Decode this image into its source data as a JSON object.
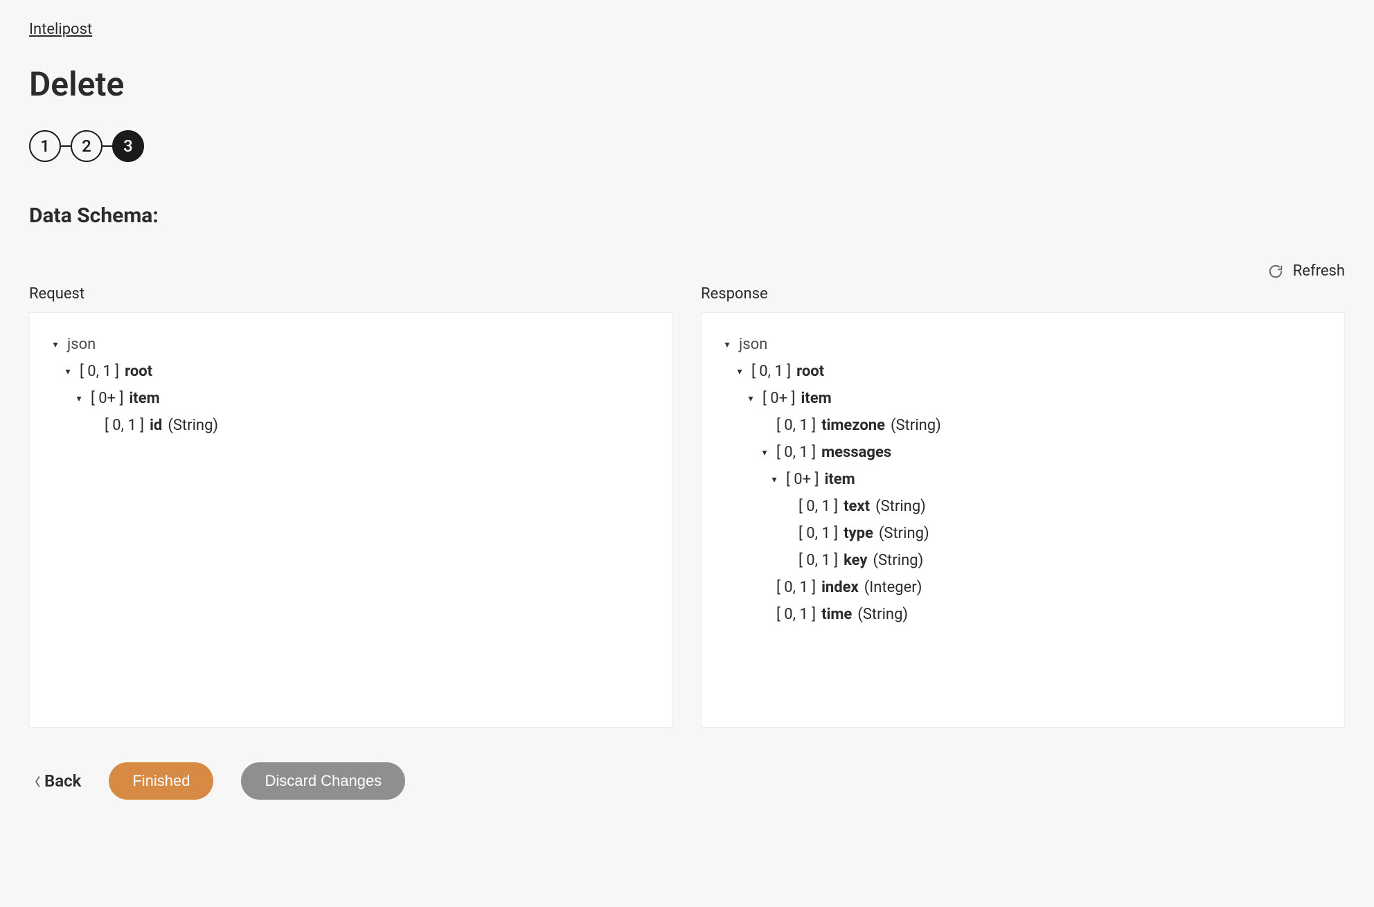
{
  "breadcrumb": "Intelipost",
  "title": "Delete",
  "steps": [
    "1",
    "2",
    "3"
  ],
  "activeStep": 2,
  "sectionTitle": "Data Schema:",
  "refresh": "Refresh",
  "request": {
    "label": "Request",
    "json": "json",
    "rootCard": "[ 0, 1 ]",
    "rootName": "root",
    "itemCard": "[ 0+ ]",
    "itemName": "item",
    "idCard": "[ 0, 1 ]",
    "idName": "id",
    "idType": "(String)"
  },
  "response": {
    "label": "Response",
    "json": "json",
    "rootCard": "[ 0, 1 ]",
    "rootName": "root",
    "itemCard": "[ 0+ ]",
    "itemName": "item",
    "timezoneCard": "[ 0, 1 ]",
    "timezoneName": "timezone",
    "timezoneType": "(String)",
    "messagesCard": "[ 0, 1 ]",
    "messagesName": "messages",
    "msgItemCard": "[ 0+ ]",
    "msgItemName": "item",
    "textCard": "[ 0, 1 ]",
    "textName": "text",
    "textType": "(String)",
    "typeCard": "[ 0, 1 ]",
    "typeName": "type",
    "typeType": "(String)",
    "keyCard": "[ 0, 1 ]",
    "keyName": "key",
    "keyType": "(String)",
    "indexCard": "[ 0, 1 ]",
    "indexName": "index",
    "indexType": "(Integer)",
    "timeCard": "[ 0, 1 ]",
    "timeName": "time",
    "timeType": "(String)"
  },
  "actions": {
    "back": "Back",
    "finished": "Finished",
    "discard": "Discard Changes"
  }
}
